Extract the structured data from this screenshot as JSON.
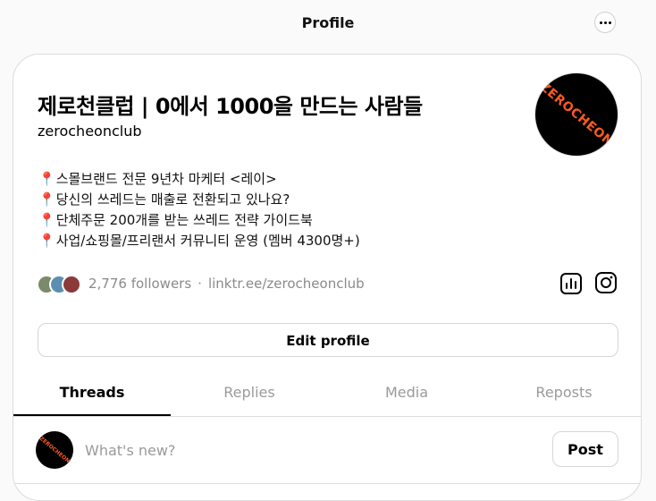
{
  "header": {
    "title": "Profile",
    "more_icon": "more-horizontal-icon"
  },
  "profile": {
    "name": "제로천클럽 | 0에서 1000을 만드는 사람들",
    "username": "zerocheonclub",
    "avatar_text": "ZEROCHEON",
    "bio": [
      "스몰브랜드 전문 9년차 마케터 <레이>",
      "당신의 쓰레드는 매출로 전환되고 있나요?",
      "단체주문 200개를 받는 쓰레드 전략 가이드북",
      "사업/쇼핑몰/프리랜서 커뮤니티 운영 (멤버 4300명+)"
    ],
    "bio_icon": "📍",
    "followers": "2,776 followers",
    "separator": "·",
    "link": "linktr.ee/zerocheonclub",
    "insights_icon": "insights-icon",
    "instagram_icon": "instagram-icon"
  },
  "actions": {
    "edit_profile": "Edit profile"
  },
  "tabs": [
    {
      "label": "Threads",
      "active": true
    },
    {
      "label": "Replies",
      "active": false
    },
    {
      "label": "Media",
      "active": false
    },
    {
      "label": "Reposts",
      "active": false
    }
  ],
  "composer": {
    "placeholder": "What's new?",
    "post_label": "Post",
    "avatar_text": "ZEROCHEON"
  },
  "colors": {
    "accent_logo": "#ff5a1f",
    "muted_text": "#8a8a8a",
    "border": "#dcdcdc"
  }
}
